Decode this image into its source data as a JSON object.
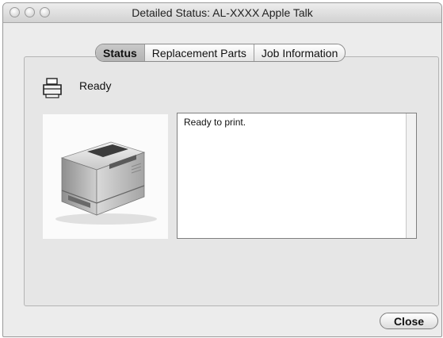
{
  "window": {
    "title": "Detailed Status: AL-XXXX  Apple Talk",
    "traffic_lights": [
      "close-traffic-icon",
      "minimize-traffic-icon",
      "zoom-traffic-icon"
    ]
  },
  "tabs": [
    {
      "label": "Status",
      "active": true
    },
    {
      "label": "Replacement Parts",
      "active": false
    },
    {
      "label": "Job Information",
      "active": false
    }
  ],
  "status": {
    "icon": "printer-status-icon",
    "label": "Ready"
  },
  "printer_image": {
    "icon": "laser-printer-image"
  },
  "message": {
    "text": "Ready to print."
  },
  "buttons": {
    "close_label": "Close"
  },
  "colors": {
    "window_background": "#ececec",
    "active_tab": "#bdbdbd"
  }
}
